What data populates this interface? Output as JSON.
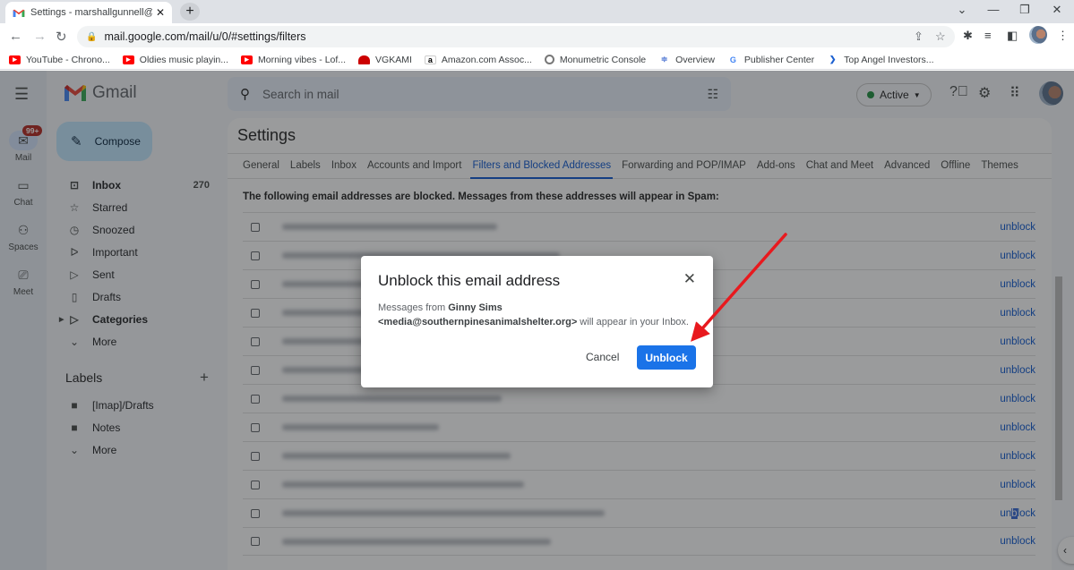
{
  "browser": {
    "tab_title": "Settings - marshallgunnell@gmai",
    "new_tab_glyph": "+",
    "url": "mail.google.com/mail/u/0/#settings/filters",
    "bookmarks": [
      {
        "label": "YouTube - Chrono...",
        "icon": "youtube-icon"
      },
      {
        "label": "Oldies music playin...",
        "icon": "youtube-icon"
      },
      {
        "label": "Morning vibes - Lof...",
        "icon": "youtube-icon"
      },
      {
        "label": "VGKAMI",
        "icon": "vgkami-icon"
      },
      {
        "label": "Amazon.com Assoc...",
        "icon": "amazon-icon"
      },
      {
        "label": "Monumetric Console",
        "icon": "monumetric-icon"
      },
      {
        "label": "Overview",
        "icon": "overview-icon"
      },
      {
        "label": "Publisher Center",
        "icon": "google-icon"
      },
      {
        "label": "Top Angel Investors...",
        "icon": "angel-icon"
      }
    ]
  },
  "gmail": {
    "brand": "Gmail",
    "rail": [
      {
        "label": "Mail",
        "badge": "99+"
      },
      {
        "label": "Chat"
      },
      {
        "label": "Spaces"
      },
      {
        "label": "Meet"
      }
    ],
    "compose": "Compose",
    "nav": [
      {
        "label": "Inbox",
        "count": "270",
        "bold": true
      },
      {
        "label": "Starred"
      },
      {
        "label": "Snoozed"
      },
      {
        "label": "Important"
      },
      {
        "label": "Sent"
      },
      {
        "label": "Drafts"
      },
      {
        "label": "Categories",
        "bold": true
      },
      {
        "label": "More"
      }
    ],
    "labels_heading": "Labels",
    "labels": [
      {
        "label": "[Imap]/Drafts"
      },
      {
        "label": "Notes"
      },
      {
        "label": "More"
      }
    ],
    "search_placeholder": "Search in mail",
    "status": "Active",
    "status_color": "#1e8e3e"
  },
  "settings": {
    "title": "Settings",
    "tabs": [
      "General",
      "Labels",
      "Inbox",
      "Accounts and Import",
      "Filters and Blocked Addresses",
      "Forwarding and POP/IMAP",
      "Add-ons",
      "Chat and Meet",
      "Advanced",
      "Offline",
      "Themes"
    ],
    "selected_tab": "Filters and Blocked Addresses",
    "intro": "The following email addresses are blocked. Messages from these addresses will appear in Spam:",
    "blocked_rows_count": 12,
    "unblock_label": "unblock"
  },
  "dialog": {
    "title": "Unblock this email address",
    "msg_prefix": "Messages from ",
    "sender_name": "Ginny Sims",
    "sender_email": "<media@southernpinesanimalshelter.org>",
    "msg_suffix": " will appear in your Inbox.",
    "cancel": "Cancel",
    "confirm": "Unblock",
    "accent": "#1a73e8"
  },
  "annotation": {
    "type": "red-arrow",
    "color": "#e8191e",
    "points_to": "Unblock button"
  }
}
